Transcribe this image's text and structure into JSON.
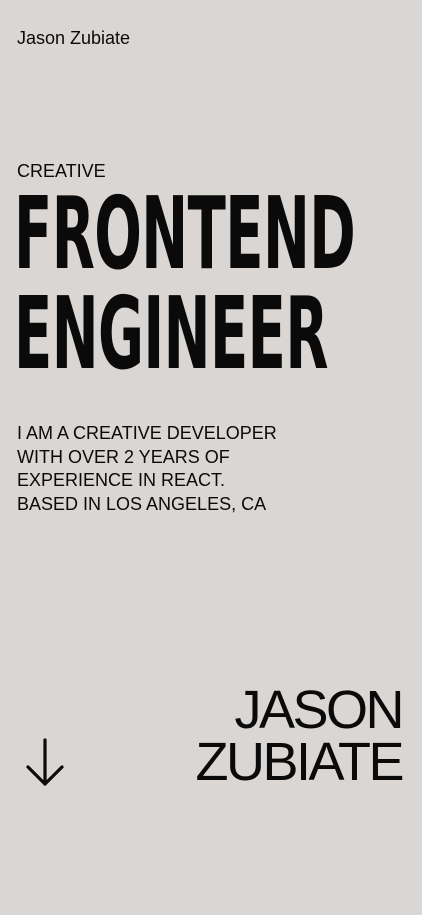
{
  "header": {
    "brand_name": "Jason Zubiate"
  },
  "hero": {
    "eyebrow": "CREATIVE",
    "headline_line1": "FRONTEND",
    "headline_line2": "ENGINEER",
    "bio_lines": [
      "I AM A CREATIVE DEVELOPER",
      "WITH OVER 2 YEARS OF",
      "EXPERIENCE IN REACT.",
      "BASED IN LOS ANGELES, CA"
    ]
  },
  "footer": {
    "scroll_icon": "arrow-down-icon",
    "name_line1": "JASON",
    "name_line2": "ZUBIATE"
  },
  "colors": {
    "background": "#d9d6d3",
    "text": "#0a0a0a"
  }
}
